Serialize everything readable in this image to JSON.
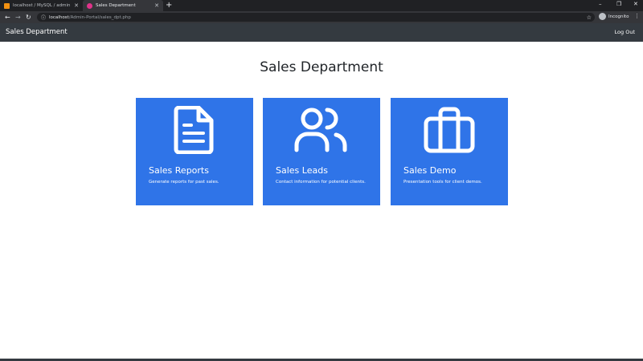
{
  "browser": {
    "tabs": [
      {
        "title": "localhost / MySQL / admin / user",
        "favicon_color": "#f29111",
        "active": false
      },
      {
        "title": "Sales Department",
        "favicon_color": "#e0338a",
        "active": true
      }
    ],
    "new_tab": "+",
    "url_host": "localhost",
    "url_path": "/Admin-Portal/sales_dpt.php",
    "profile_label": "Incognito",
    "window_controls": {
      "minimize": "–",
      "restore": "❐",
      "close": "✕"
    },
    "nav": {
      "back": "←",
      "forward": "→",
      "reload": "↻"
    }
  },
  "navbar": {
    "brand": "Sales Department",
    "logout": "Log Out"
  },
  "page": {
    "title": "Sales Department",
    "accent_color": "#2f74e8",
    "cards": [
      {
        "icon": "document-icon",
        "title": "Sales Reports",
        "description": "Generate reports for past sales."
      },
      {
        "icon": "users-icon",
        "title": "Sales Leads",
        "description": "Contact information for potential clients."
      },
      {
        "icon": "briefcase-icon",
        "title": "Sales Demo",
        "description": "Presentation tools for client demos."
      }
    ]
  }
}
